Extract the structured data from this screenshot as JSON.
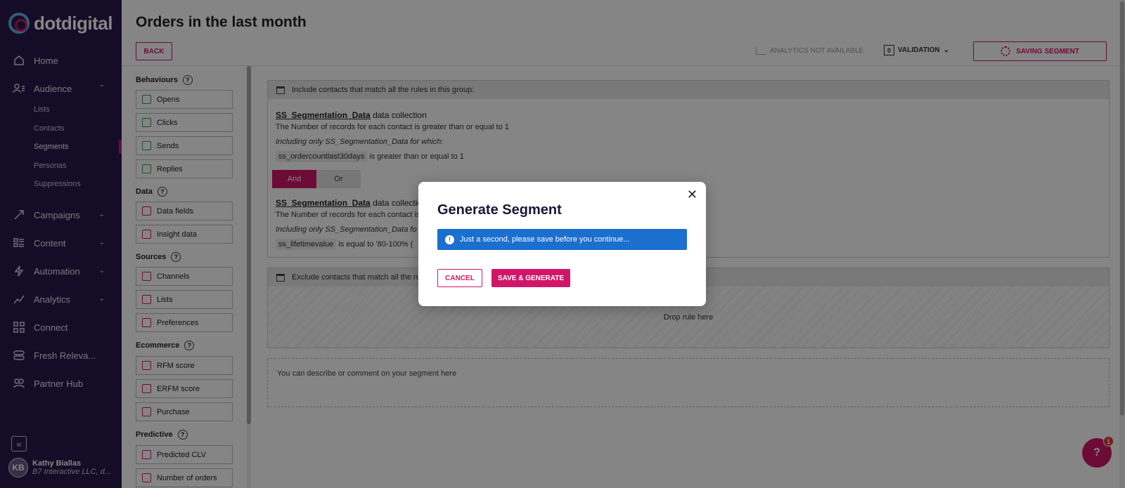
{
  "brand": {
    "name": "dotdigital"
  },
  "nav": {
    "items": [
      {
        "label": "Home",
        "icon": "home-icon"
      },
      {
        "label": "Audience",
        "icon": "audience-icon"
      },
      {
        "label": "Campaigns",
        "icon": "campaigns-icon"
      },
      {
        "label": "Content",
        "icon": "content-icon"
      },
      {
        "label": "Automation",
        "icon": "automation-icon"
      },
      {
        "label": "Analytics",
        "icon": "analytics-icon"
      },
      {
        "label": "Connect",
        "icon": "connect-icon"
      },
      {
        "label": "Fresh Releva...",
        "icon": "fresh-relevance-icon"
      },
      {
        "label": "Partner Hub",
        "icon": "partner-hub-icon"
      }
    ],
    "audience_sub": [
      "Lists",
      "Contacts",
      "Segments",
      "Personas",
      "Suppressions"
    ]
  },
  "user": {
    "initials": "KB",
    "name": "Kathy Biallas",
    "org": "B7 Interactive LLC, d..."
  },
  "page": {
    "title": "Orders in the last month",
    "back_label": "BACK",
    "analytics_label": "ANALYTICS NOT AVAILABLE",
    "validation_count": "0",
    "validation_label": "VALIDATION",
    "saving_label": "SAVING SEGMENT"
  },
  "rules": {
    "behaviours": {
      "heading": "Behaviours",
      "items": [
        "Opens",
        "Clicks",
        "Sends",
        "Replies"
      ]
    },
    "data": {
      "heading": "Data",
      "items": [
        "Data fields",
        "Insight data"
      ]
    },
    "sources": {
      "heading": "Sources",
      "items": [
        "Channels",
        "Lists",
        "Preferences"
      ]
    },
    "ecommerce": {
      "heading": "Ecommerce",
      "items": [
        "RFM score",
        "ERFM score",
        "Purchase"
      ]
    },
    "predictive": {
      "heading": "Predictive",
      "items": [
        "Predicted CLV",
        "Number of orders"
      ]
    }
  },
  "builder": {
    "include_header": "Include contacts that match all the rules in this group:",
    "rule1": {
      "collection": "SS_Segmentation_Data",
      "suffix": "data collection",
      "line": "The Number of records for each contact is greater than or equal to 1",
      "italic": "Including only SS_Segmentation_Data for which:",
      "field": "ss_ordercountlast30days",
      "condition": "is greater than or equal to 1"
    },
    "and_label": "And",
    "or_label": "Or",
    "rule2": {
      "collection": "SS_Segmentation_Data",
      "suffix": "data collection",
      "line": "The Number of records for each contact is",
      "italic": "Including only SS_Segmentation_Data fo",
      "field": "ss_lifetimevalue",
      "condition": "is equal to '80-100% ("
    },
    "exclude_header": "Exclude contacts that match all the rule",
    "drop_label": "Drop rule here",
    "comment_placeholder": "You can describe or comment on your segment here"
  },
  "chat": {
    "badge": "1",
    "glyph": "?"
  },
  "modal": {
    "title": "Generate Segment",
    "alert": "Just a second, please save before you continue...",
    "cancel_label": "CANCEL",
    "save_label": "SAVE & GENERATE",
    "close_glyph": "✕"
  },
  "colors": {
    "accent": "#d1166a",
    "sidebar": "#2a1a4e",
    "info": "#1a6fcf"
  }
}
